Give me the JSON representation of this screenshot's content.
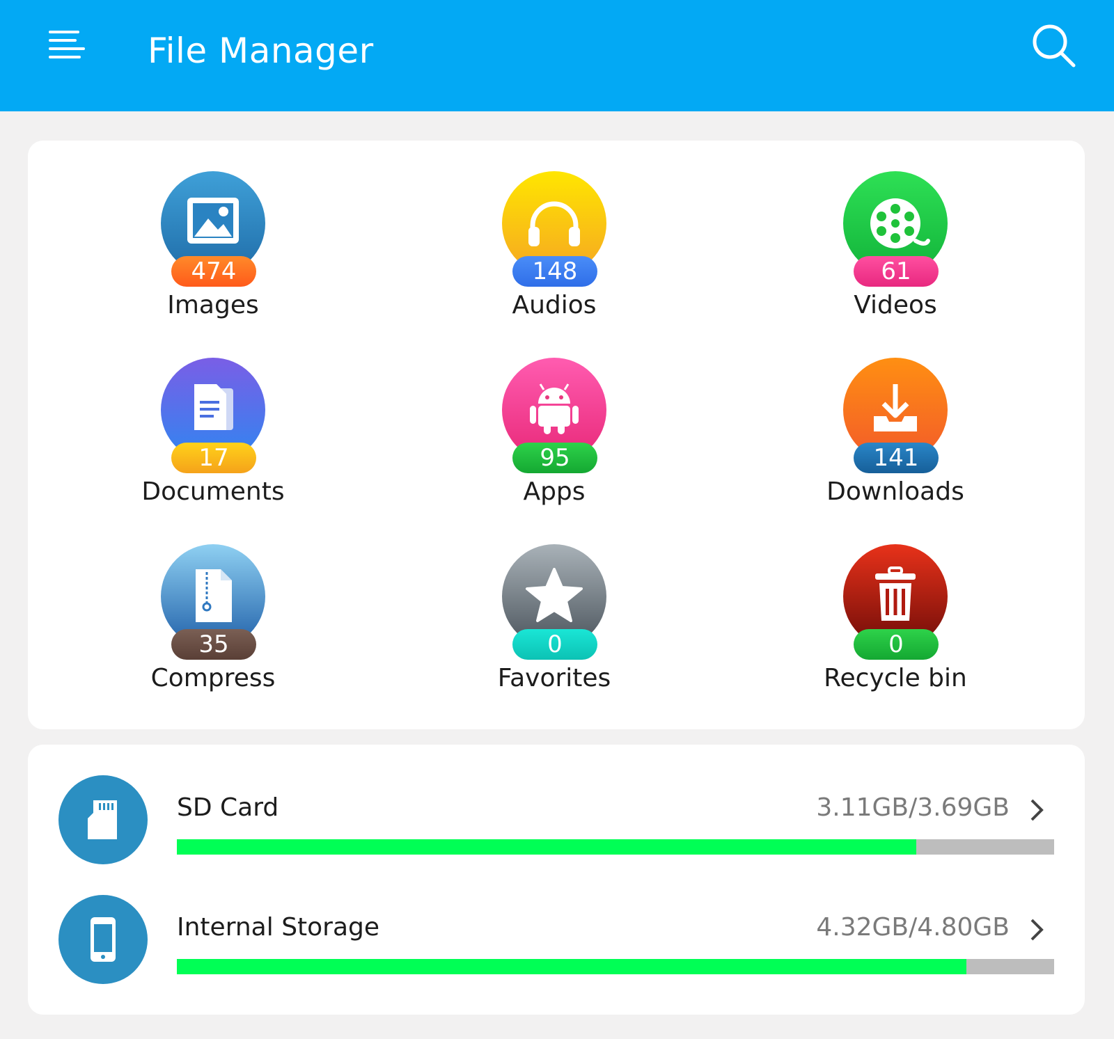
{
  "appbar": {
    "title": "File Manager",
    "menu_icon": "menu-icon",
    "search_icon": "search-icon",
    "color": "#03a9f4"
  },
  "categories": [
    {
      "label": "Images",
      "count": "474",
      "icon": "image-icon",
      "badge_color": "#ff6d1f"
    },
    {
      "label": "Audios",
      "count": "148",
      "icon": "headphones-icon",
      "badge_color": "#3d7ef5"
    },
    {
      "label": "Videos",
      "count": "61",
      "icon": "film-reel-icon",
      "badge_color": "#f2398e"
    },
    {
      "label": "Documents",
      "count": "17",
      "icon": "document-icon",
      "badge_color": "#f5b51a"
    },
    {
      "label": "Apps",
      "count": "95",
      "icon": "android-icon",
      "badge_color": "#1fc23a"
    },
    {
      "label": "Downloads",
      "count": "141",
      "icon": "download-icon",
      "badge_color": "#1e74b3"
    },
    {
      "label": "Compress",
      "count": "35",
      "icon": "zip-file-icon",
      "badge_color": "#6b4f44"
    },
    {
      "label": "Favorites",
      "count": "0",
      "icon": "star-icon",
      "badge_color": "#14d6c8"
    },
    {
      "label": "Recycle bin",
      "count": "0",
      "icon": "trash-icon",
      "badge_color": "#1fc23a"
    }
  ],
  "storage": [
    {
      "name": "SD Card",
      "usage": "3.11GB/3.69GB",
      "used_fraction": 0.843,
      "icon": "sd-card-icon"
    },
    {
      "name": "Internal Storage",
      "usage": "4.32GB/4.80GB",
      "used_fraction": 0.9,
      "icon": "phone-icon"
    }
  ]
}
